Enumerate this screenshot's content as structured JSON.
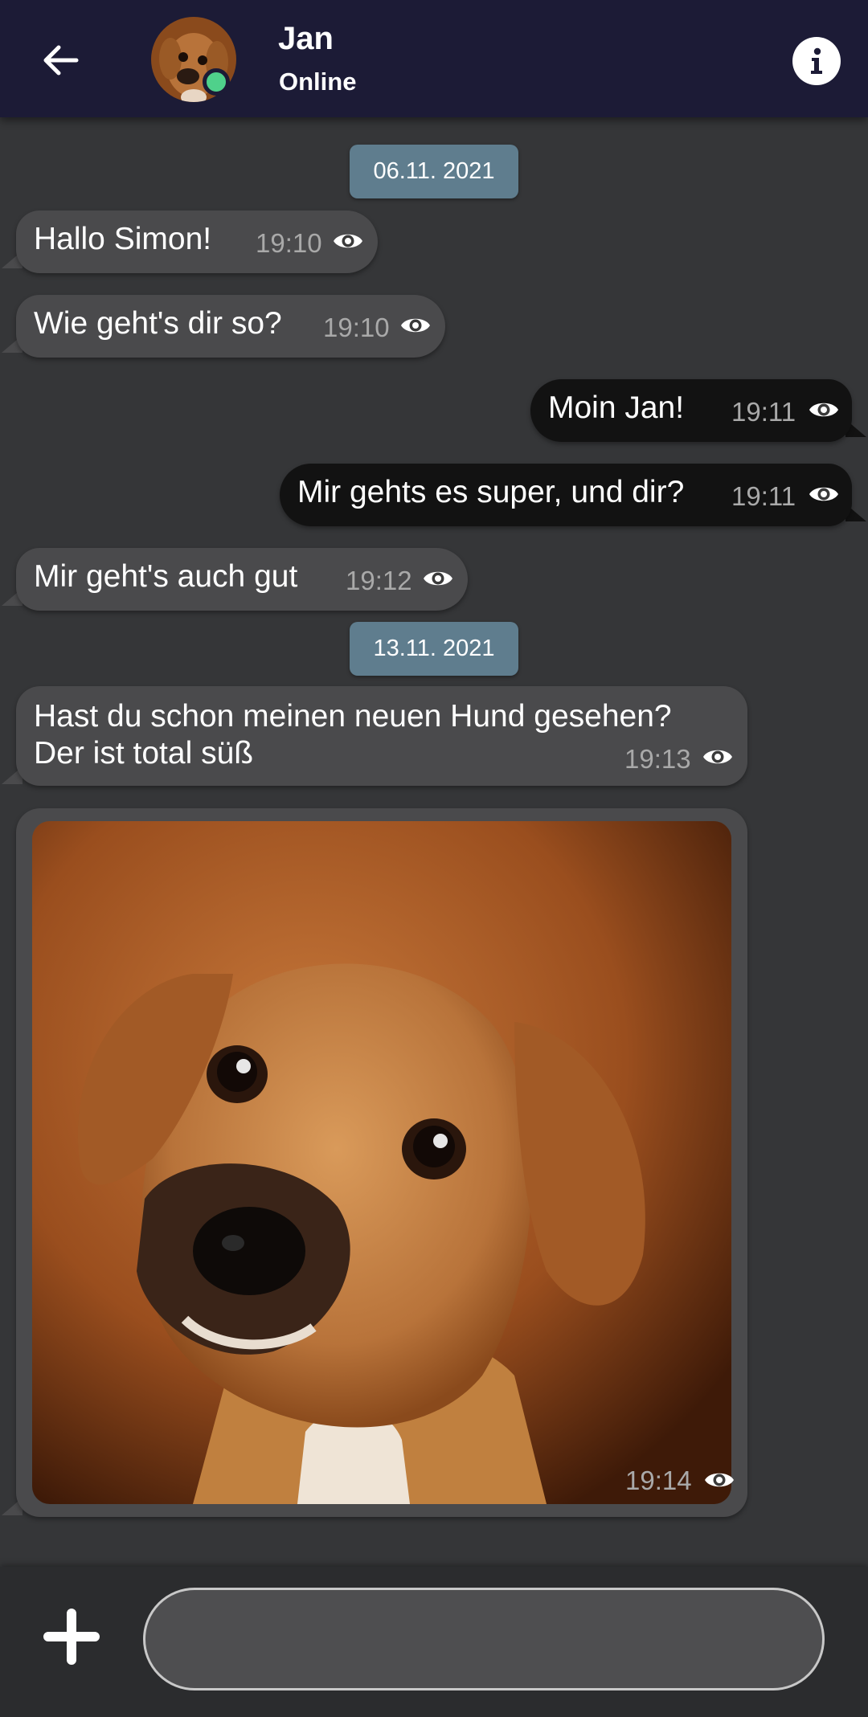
{
  "header": {
    "contact_name": "Jan",
    "contact_status": "Online",
    "icons": {
      "back": "arrow-left-icon",
      "info": "info-icon"
    }
  },
  "messages": [
    {
      "type": "date",
      "label": "06.11. 2021"
    },
    {
      "type": "incoming",
      "text": "Hallo Simon!",
      "time": "19:10",
      "read": true
    },
    {
      "type": "incoming",
      "text": "Wie geht's dir so?",
      "time": "19:10",
      "read": true
    },
    {
      "type": "outgoing",
      "text": "Moin Jan!",
      "time": "19:11",
      "read": true
    },
    {
      "type": "outgoing",
      "text": "Mir gehts es super, und dir?",
      "time": "19:11",
      "read": true
    },
    {
      "type": "incoming",
      "text": "Mir geht's auch gut",
      "time": "19:12",
      "read": true
    },
    {
      "type": "date",
      "label": "13.11. 2021"
    },
    {
      "type": "incoming",
      "lines": [
        "Hast du schon meinen neuen Hund gesehen?",
        "Der ist total süß"
      ],
      "time": "19:13",
      "read": true
    },
    {
      "type": "incoming-image",
      "image": "dog-photo",
      "time": "19:14",
      "read": true
    }
  ],
  "composer": {
    "placeholder": "",
    "icons": {
      "add": "plus-icon"
    }
  },
  "colors": {
    "background": "#353638",
    "header": "#1c1b36",
    "incoming_bubble": "#4a4a4c",
    "outgoing_bubble": "#121212",
    "date_chip": "#5f7d8e",
    "online": "#4fd18b"
  }
}
